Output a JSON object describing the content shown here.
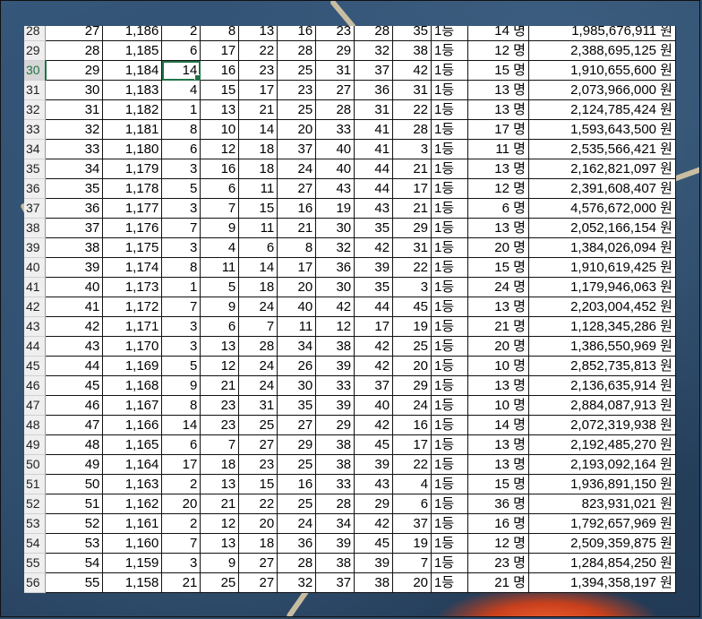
{
  "sheet": {
    "selected": {
      "row_header": "30",
      "col": 3
    },
    "rows": [
      [
        "28",
        "27",
        "1,186",
        "2",
        "8",
        "13",
        "16",
        "23",
        "28",
        "35",
        "1등",
        "14 명",
        "1,985,676,911 원"
      ],
      [
        "29",
        "28",
        "1,185",
        "6",
        "17",
        "22",
        "28",
        "29",
        "32",
        "38",
        "1등",
        "12 명",
        "2,388,695,125 원"
      ],
      [
        "30",
        "29",
        "1,184",
        "14",
        "16",
        "23",
        "25",
        "31",
        "37",
        "42",
        "1등",
        "15 명",
        "1,910,655,600 원"
      ],
      [
        "31",
        "30",
        "1,183",
        "4",
        "15",
        "17",
        "23",
        "27",
        "36",
        "31",
        "1등",
        "13 명",
        "2,073,966,000 원"
      ],
      [
        "32",
        "31",
        "1,182",
        "1",
        "13",
        "21",
        "25",
        "28",
        "31",
        "22",
        "1등",
        "13 명",
        "2,124,785,424 원"
      ],
      [
        "33",
        "32",
        "1,181",
        "8",
        "10",
        "14",
        "20",
        "33",
        "41",
        "28",
        "1등",
        "17 명",
        "1,593,643,500 원"
      ],
      [
        "34",
        "33",
        "1,180",
        "6",
        "12",
        "18",
        "37",
        "40",
        "41",
        "3",
        "1등",
        "11 명",
        "2,535,566,421 원"
      ],
      [
        "35",
        "34",
        "1,179",
        "3",
        "16",
        "18",
        "24",
        "40",
        "44",
        "21",
        "1등",
        "13 명",
        "2,162,821,097 원"
      ],
      [
        "36",
        "35",
        "1,178",
        "5",
        "6",
        "11",
        "27",
        "43",
        "44",
        "17",
        "1등",
        "12 명",
        "2,391,608,407 원"
      ],
      [
        "37",
        "36",
        "1,177",
        "3",
        "7",
        "15",
        "16",
        "19",
        "43",
        "21",
        "1등",
        "6 명",
        "4,576,672,000 원"
      ],
      [
        "38",
        "37",
        "1,176",
        "7",
        "9",
        "11",
        "21",
        "30",
        "35",
        "29",
        "1등",
        "13 명",
        "2,052,166,154 원"
      ],
      [
        "39",
        "38",
        "1,175",
        "3",
        "4",
        "6",
        "8",
        "32",
        "42",
        "31",
        "1등",
        "20 명",
        "1,384,026,094 원"
      ],
      [
        "40",
        "39",
        "1,174",
        "8",
        "11",
        "14",
        "17",
        "36",
        "39",
        "22",
        "1등",
        "15 명",
        "1,910,619,425 원"
      ],
      [
        "41",
        "40",
        "1,173",
        "1",
        "5",
        "18",
        "20",
        "30",
        "35",
        "3",
        "1등",
        "24 명",
        "1,179,946,063 원"
      ],
      [
        "42",
        "41",
        "1,172",
        "7",
        "9",
        "24",
        "40",
        "42",
        "44",
        "45",
        "1등",
        "13 명",
        "2,203,004,452 원"
      ],
      [
        "43",
        "42",
        "1,171",
        "3",
        "6",
        "7",
        "11",
        "12",
        "17",
        "19",
        "1등",
        "21 명",
        "1,128,345,286 원"
      ],
      [
        "44",
        "43",
        "1,170",
        "3",
        "13",
        "28",
        "34",
        "38",
        "42",
        "25",
        "1등",
        "20 명",
        "1,386,550,969 원"
      ],
      [
        "45",
        "44",
        "1,169",
        "5",
        "12",
        "24",
        "26",
        "39",
        "42",
        "20",
        "1등",
        "10 명",
        "2,852,735,813 원"
      ],
      [
        "46",
        "45",
        "1,168",
        "9",
        "21",
        "24",
        "30",
        "33",
        "37",
        "29",
        "1등",
        "13 명",
        "2,136,635,914 원"
      ],
      [
        "47",
        "46",
        "1,167",
        "8",
        "23",
        "31",
        "35",
        "39",
        "40",
        "24",
        "1등",
        "10 명",
        "2,884,087,913 원"
      ],
      [
        "48",
        "47",
        "1,166",
        "14",
        "23",
        "25",
        "27",
        "29",
        "42",
        "16",
        "1등",
        "14 명",
        "2,072,319,938 원"
      ],
      [
        "49",
        "48",
        "1,165",
        "6",
        "7",
        "27",
        "29",
        "38",
        "45",
        "17",
        "1등",
        "13 명",
        "2,192,485,270 원"
      ],
      [
        "50",
        "49",
        "1,164",
        "17",
        "18",
        "23",
        "25",
        "38",
        "39",
        "22",
        "1등",
        "13 명",
        "2,193,092,164 원"
      ],
      [
        "51",
        "50",
        "1,163",
        "2",
        "13",
        "15",
        "16",
        "33",
        "43",
        "4",
        "1등",
        "15 명",
        "1,936,891,150 원"
      ],
      [
        "52",
        "51",
        "1,162",
        "20",
        "21",
        "22",
        "25",
        "28",
        "29",
        "6",
        "1등",
        "36 명",
        "823,931,021 원"
      ],
      [
        "53",
        "52",
        "1,161",
        "2",
        "12",
        "20",
        "24",
        "34",
        "42",
        "37",
        "1등",
        "16 명",
        "1,792,657,969 원"
      ],
      [
        "54",
        "53",
        "1,160",
        "7",
        "13",
        "18",
        "36",
        "39",
        "45",
        "19",
        "1등",
        "12 명",
        "2,509,359,875 원"
      ],
      [
        "55",
        "54",
        "1,159",
        "3",
        "9",
        "27",
        "28",
        "38",
        "39",
        "7",
        "1등",
        "23 명",
        "1,284,854,250 원"
      ],
      [
        "56",
        "55",
        "1,158",
        "21",
        "25",
        "27",
        "32",
        "37",
        "38",
        "20",
        "1등",
        "21 명",
        "1,394,358,197 원"
      ]
    ]
  }
}
